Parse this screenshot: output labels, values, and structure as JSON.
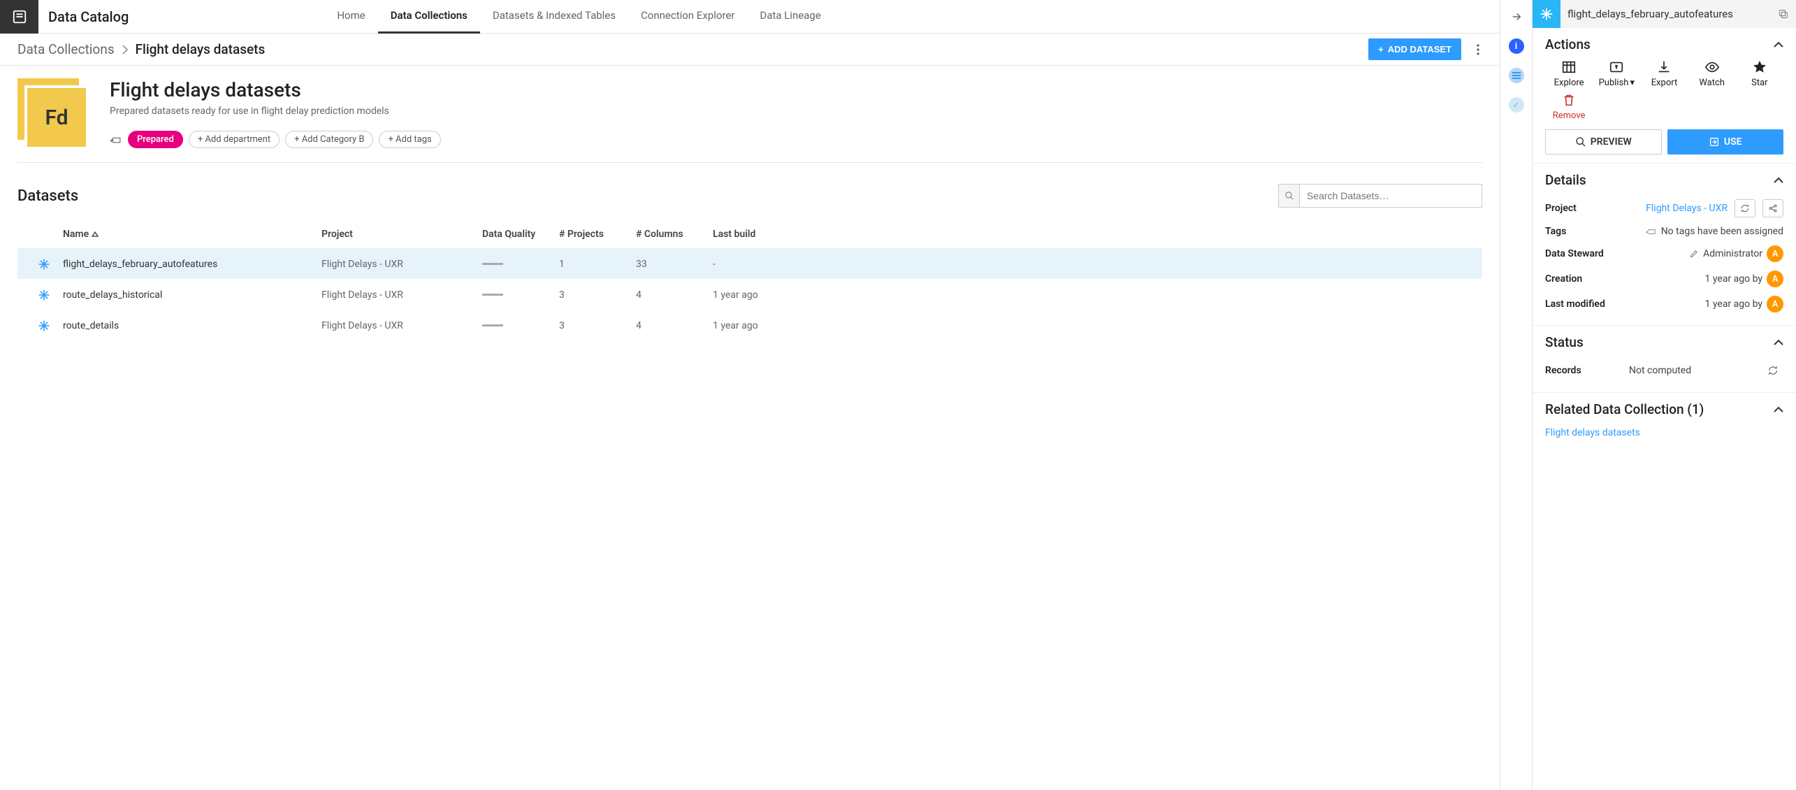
{
  "app_title": "Data Catalog",
  "nav": {
    "home": "Home",
    "collections": "Data Collections",
    "datasets": "Datasets & Indexed Tables",
    "explorer": "Connection Explorer",
    "lineage": "Data Lineage"
  },
  "breadcrumb": {
    "root": "Data Collections",
    "current": "Flight delays datasets"
  },
  "add_dataset_label": "ADD DATASET",
  "hero": {
    "abbr": "Fd",
    "title": "Flight delays datasets",
    "description": "Prepared datasets ready for use in flight delay prediction models",
    "tag_prepared": "Prepared",
    "tag_dept": "+ Add department",
    "tag_catb": "+ Add Category B",
    "tag_add": "+ Add tags"
  },
  "datasets_section": {
    "title": "Datasets",
    "search_placeholder": "Search Datasets…",
    "columns": {
      "name": "Name",
      "project": "Project",
      "quality": "Data Quality",
      "projects_count": "# Projects",
      "columns_count": "# Columns",
      "last_build": "Last build"
    },
    "rows": [
      {
        "name": "flight_delays_february_autofeatures",
        "project": "Flight Delays - UXR",
        "projects": "1",
        "columns": "33",
        "last_build": "-",
        "selected": true
      },
      {
        "name": "route_delays_historical",
        "project": "Flight Delays - UXR",
        "projects": "3",
        "columns": "4",
        "last_build": "1 year ago",
        "selected": false
      },
      {
        "name": "route_details",
        "project": "Flight Delays - UXR",
        "projects": "3",
        "columns": "4",
        "last_build": "1 year ago",
        "selected": false
      }
    ]
  },
  "detail": {
    "title": "flight_delays_february_autofeatures",
    "actions_title": "Actions",
    "actions": {
      "explore": "Explore",
      "publish": "Publish",
      "export": "Export",
      "watch": "Watch",
      "star": "Star",
      "remove": "Remove"
    },
    "preview_label": "PREVIEW",
    "use_label": "USE",
    "details_title": "Details",
    "details": {
      "project_k": "Project",
      "project_v": "Flight Delays - UXR",
      "tags_k": "Tags",
      "tags_v": "No tags have been assigned",
      "steward_k": "Data Steward",
      "steward_v": "Administrator",
      "creation_k": "Creation",
      "creation_v": "1 year ago by",
      "modified_k": "Last modified",
      "modified_v": "1 year ago by"
    },
    "status_title": "Status",
    "status": {
      "records_k": "Records",
      "records_v": "Not computed"
    },
    "related_title": "Related Data Collection (1)",
    "related_link": "Flight delays datasets"
  }
}
